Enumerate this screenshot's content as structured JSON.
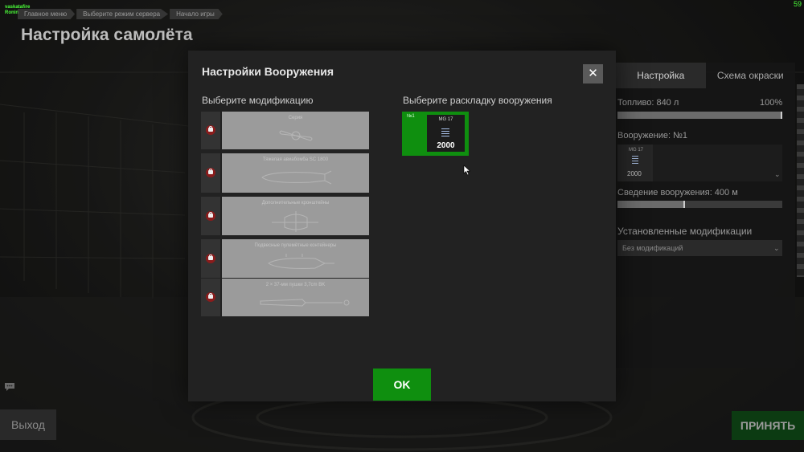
{
  "hud": {
    "user_line1": "vaskatafire",
    "user_line2": "Ronin",
    "fps": "59"
  },
  "breadcrumbs": [
    "Главное меню",
    "Выберите режим сервера",
    "Начало игры"
  ],
  "page_title": "Настройка самолёта",
  "side_panel": {
    "tabs": [
      "Настройка",
      "Схема окраски"
    ],
    "fuel_label": "Топливо: 840 л",
    "fuel_percent": "100%",
    "fuel_fraction": 1.0,
    "armament_label": "Вооружение: №1",
    "armament_weapon": "MG 17",
    "armament_count": "2000",
    "convergence_label": "Сведение вооружения: 400 м",
    "convergence_fraction": 0.41,
    "mods_label": "Установленные модификации",
    "mods_value": "Без модификаций"
  },
  "footer": {
    "exit": "Выход",
    "accept": "ПРИНЯТЬ"
  },
  "modal": {
    "title": "Настройки Вооружения",
    "close_glyph": "✕",
    "mods_heading": "Выберите модификацию",
    "loadout_heading": "Выберите раскладку вооружения",
    "modifications": [
      {
        "name": "Серия",
        "locked": true
      },
      {
        "name": "Тяжелая авиабомба SC 1800",
        "locked": true
      },
      {
        "name": "Дополнительные кронштейны",
        "locked": true
      },
      {
        "name": "Подвесные пулемётные контейнеры",
        "locked": true
      },
      {
        "name": "2 × 37-мм пушки 3,7cm BK",
        "locked": true
      }
    ],
    "loadouts": [
      {
        "number": "№1",
        "weapon": "MG 17",
        "count": "2000",
        "selected": true
      }
    ],
    "ok": "OK"
  },
  "colors": {
    "accent_green": "#0f8f0f",
    "lock_red": "#8a1c1c",
    "hud_green": "#4cff3a"
  }
}
